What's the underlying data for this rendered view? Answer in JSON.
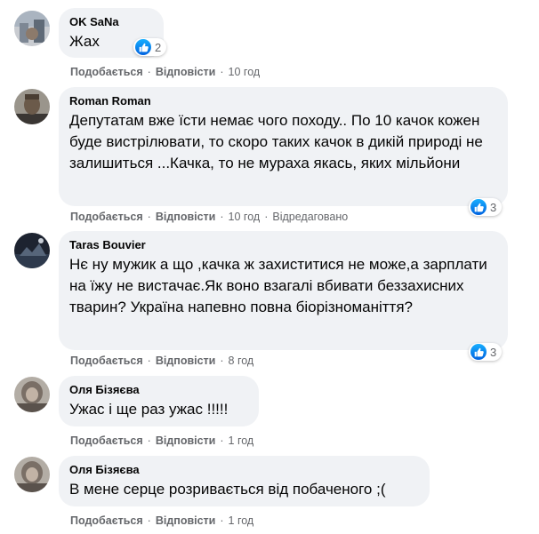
{
  "comments": [
    {
      "author": "OK SaNa",
      "text": "Жах",
      "like_label": "Подобається",
      "reply_label": "Відповісти",
      "time": "10 год",
      "edited": "",
      "reaction_count": "2"
    },
    {
      "author": "Roman Roman",
      "text": "Депутатам вже їсти немає чого походу.. По 10 качок кожен буде вистрілювати, то скоро таких качок в дикій природі не залишиться ...Качка, то не мураха якась, яких мільйони",
      "like_label": "Подобається",
      "reply_label": "Відповісти",
      "time": "10 год",
      "edited": "Відредаговано",
      "reaction_count": "3"
    },
    {
      "author": "Taras Bouvier",
      "text": "Нє ну мужик а що ,качка ж захиститися не може,а зарплати на їжу не вистачає.Як воно взагалі вбивати беззахисних тварин? Україна напевно повна біорізноманіття?",
      "like_label": "Подобається",
      "reply_label": "Відповісти",
      "time": "8 год",
      "edited": "",
      "reaction_count": "3"
    },
    {
      "author": "Оля Бізяєва",
      "text": "Ужас і ще раз ужас !!!!!",
      "like_label": "Подобається",
      "reply_label": "Відповісти",
      "time": "1 год",
      "edited": "",
      "reaction_count": ""
    },
    {
      "author": "Оля Бізяєва",
      "text": "В мене серце розривається від побаченого ;(",
      "like_label": "Подобається",
      "reply_label": "Відповісти",
      "time": "1 год",
      "edited": "",
      "reaction_count": ""
    }
  ],
  "colors": {
    "bubble": "#f0f2f5",
    "meta": "#65676b",
    "like_blue": "#1877f2"
  },
  "icons": {
    "like": "like-thumbs-up-icon"
  }
}
